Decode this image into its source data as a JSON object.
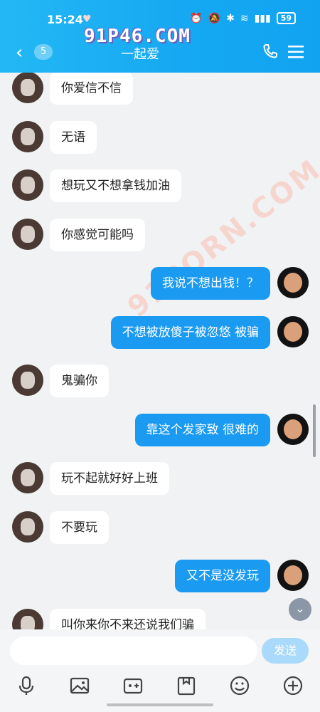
{
  "status_bar": {
    "time": "15:24",
    "battery": "59"
  },
  "header": {
    "unread_count": "5",
    "title": "一起爱",
    "watermark": "91P46.COM",
    "back_icon": "chevron-left-icon",
    "call_icon": "phone-icon",
    "menu_icon": "menu-icon"
  },
  "watermark_diagonal": "91PORN.COM",
  "messages": [
    {
      "side": "left",
      "text": "你爱信不信"
    },
    {
      "side": "left",
      "text": "无语"
    },
    {
      "side": "left",
      "text": "想玩又不想拿钱加油"
    },
    {
      "side": "left",
      "text": "你感觉可能吗"
    },
    {
      "side": "right",
      "text": "我说不想出钱！？"
    },
    {
      "side": "right",
      "text": "不想被放傻子被忽悠 被骗"
    },
    {
      "side": "left",
      "text": "鬼骗你"
    },
    {
      "side": "right",
      "text": "靠这个发家致 很难的"
    },
    {
      "side": "left",
      "text": "玩不起就好好上班"
    },
    {
      "side": "left",
      "text": "不要玩"
    },
    {
      "side": "right",
      "text": "又不是没发玩"
    },
    {
      "side": "left",
      "text": "叫你来你不来还说我们骗"
    }
  ],
  "input": {
    "placeholder": "",
    "send_label": "发送"
  },
  "toolbar": [
    "microphone-icon",
    "image-icon",
    "camera-icon",
    "file-icon",
    "emoji-icon",
    "plus-icon"
  ],
  "colors": {
    "header": "#16a9f2",
    "bubble_right": "#1b9af2",
    "bubble_left": "#ffffff",
    "send_button": "#a9dafb"
  }
}
